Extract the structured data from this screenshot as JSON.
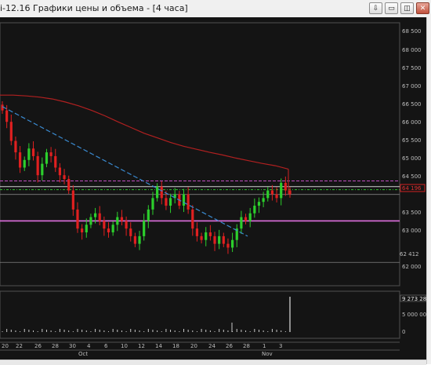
{
  "window": {
    "title": "i-12.16 Графики цены и объема - [4 часа]",
    "buttons": {
      "dropdown": "⇩",
      "minimize": "▭",
      "restore": "◫",
      "close": "✕"
    }
  },
  "price_axis": {
    "labels": [
      "68 500",
      "68 000",
      "67 500",
      "67 000",
      "66 500",
      "66 000",
      "65 500",
      "65 000",
      "64 500",
      "63 500",
      "63 000",
      "62 000"
    ],
    "current_price": "64 196",
    "low_marker": "62 412"
  },
  "volume_axis": {
    "labels": [
      "9 273 28",
      "5 000 00",
      "0"
    ]
  },
  "time_axis": {
    "days": [
      "20",
      "22",
      "26",
      "28",
      "30",
      "4",
      "6",
      "10",
      "12",
      "14",
      "18",
      "20",
      "24",
      "26",
      "28",
      "1",
      "3"
    ],
    "months": [
      "Oct",
      "Nov"
    ]
  },
  "colors": {
    "background": "#141414",
    "up_candle": "#2ccf2c",
    "down_candle": "#e02020",
    "moving_average": "#b02020",
    "trendline": "#3a8ad0",
    "support_line": "#e070e0"
  },
  "chart_data": {
    "type": "candlestick",
    "timeframe": "4 часа",
    "ylim": [
      61800,
      68700
    ],
    "close_series": [
      66400,
      66100,
      65600,
      65300,
      64900,
      65100,
      65400,
      65200,
      64700,
      65000,
      65300,
      65200,
      64900,
      64700,
      64600,
      64300,
      63800,
      63300,
      63200,
      63400,
      63600,
      63700,
      63500,
      63300,
      63200,
      63400,
      63600,
      63500,
      63300,
      63100,
      62900,
      63100,
      63500,
      63800,
      64100,
      64400,
      64100,
      63900,
      64100,
      64200,
      63900,
      64200,
      63800,
      63300,
      63100,
      63000,
      63200,
      63100,
      62900,
      63100,
      62900,
      62800,
      63000,
      63300,
      63600,
      63500,
      63700,
      63900,
      64000,
      64100,
      64300,
      64200,
      64100,
      64500,
      64300,
      64200
    ],
    "moving_average": [
      66800,
      66800,
      66780,
      66750,
      66700,
      66620,
      66520,
      66400,
      66260,
      66100,
      65950,
      65800,
      65680,
      65560,
      65460,
      65380,
      65300,
      65230,
      65150,
      65080,
      65010,
      64950,
      64860
    ],
    "horizontal_levels": [
      64550,
      64400,
      64320,
      64196,
      63500,
      62412
    ],
    "volume": {
      "ylim": [
        0,
        9273280
      ],
      "last_bar": 9273280
    }
  }
}
